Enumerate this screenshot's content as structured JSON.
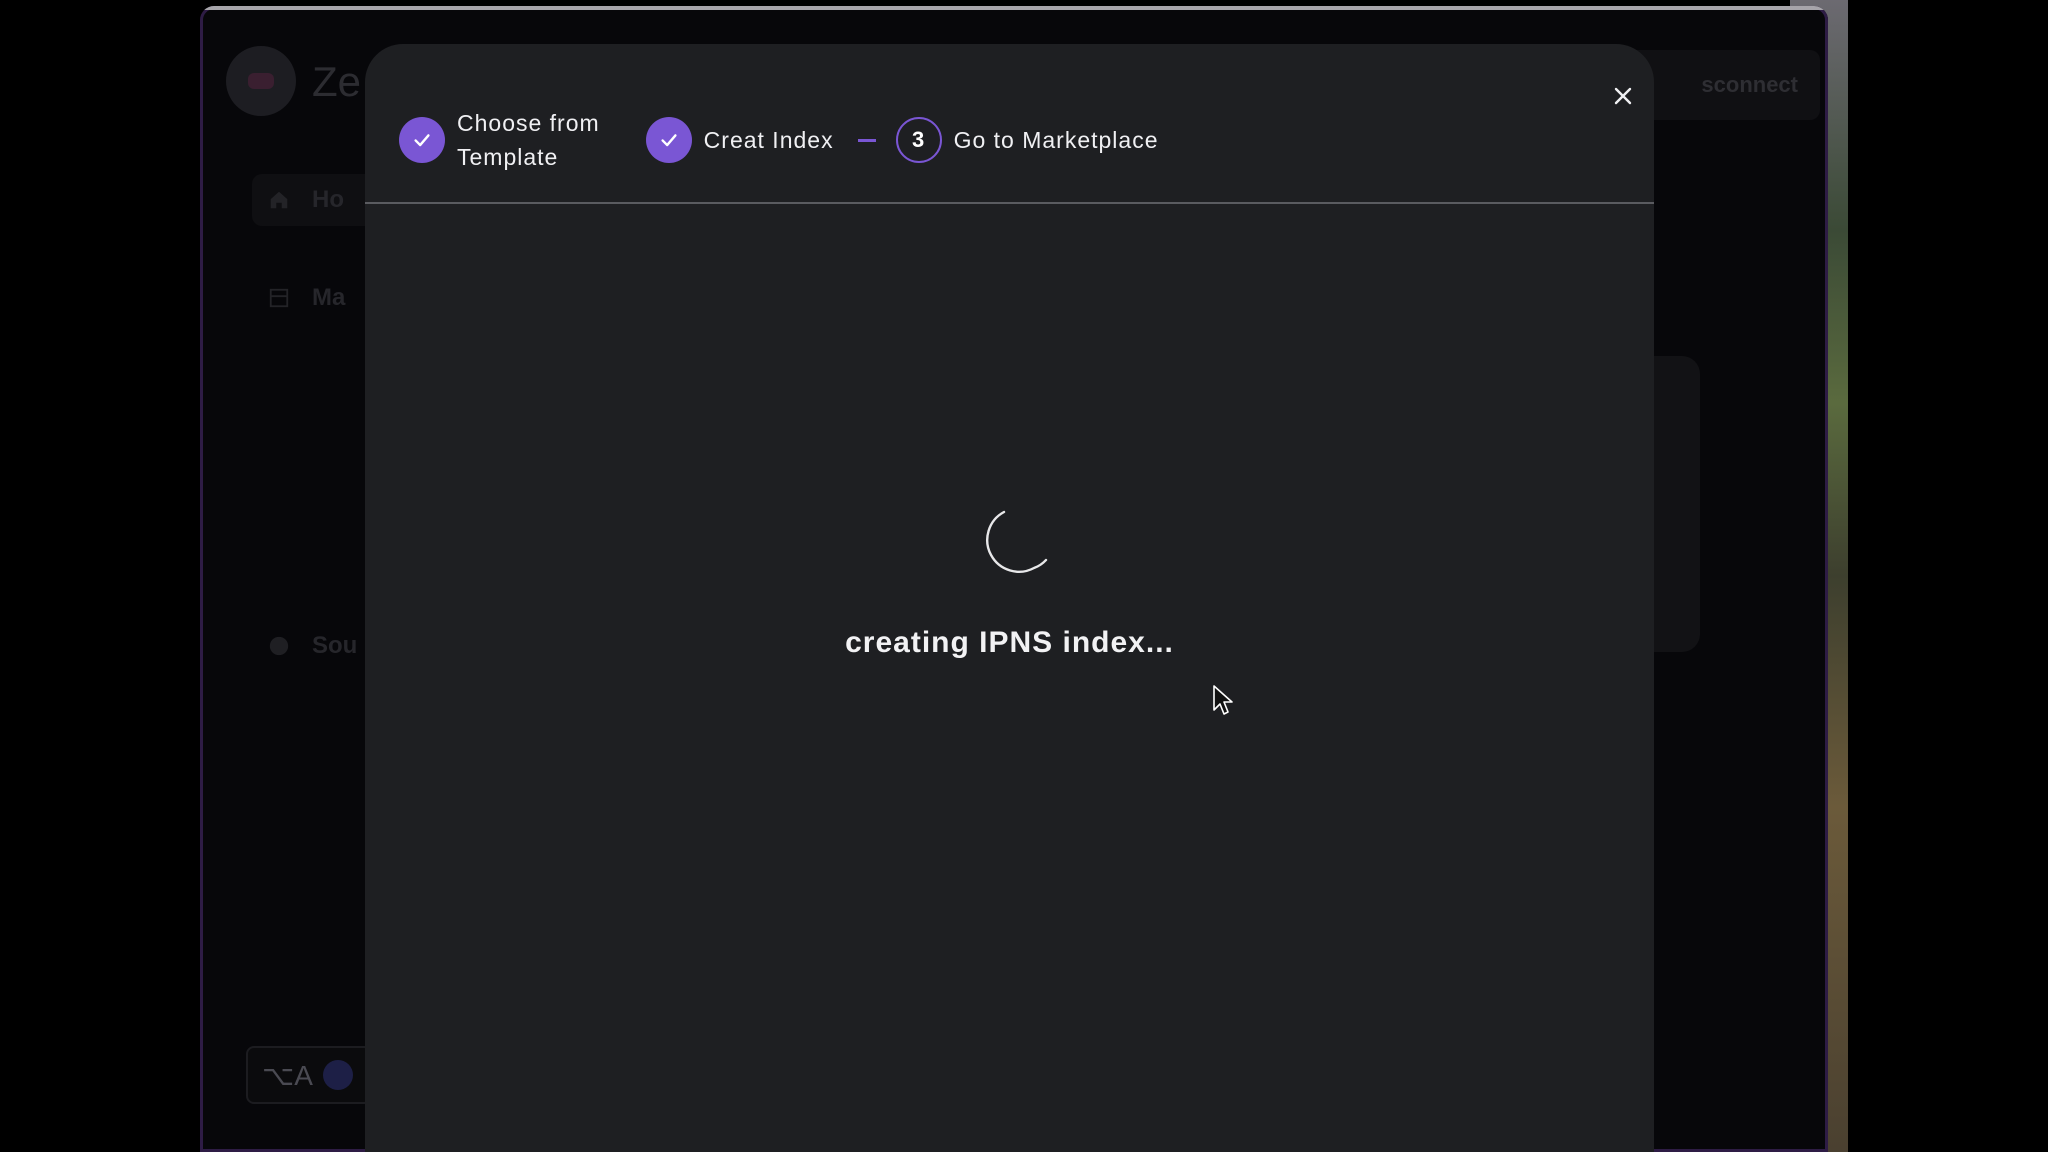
{
  "background_app": {
    "brand": "Ze",
    "nav": [
      {
        "label": "Ho",
        "icon": "home-icon"
      },
      {
        "label": "Ma",
        "icon": "grid-icon"
      },
      {
        "label": "Sou",
        "icon": "github-icon"
      }
    ],
    "disconnect_label": "sconnect",
    "keyboard_hint": "⌥A"
  },
  "modal": {
    "steps": [
      {
        "label_line1": "Choose from",
        "label_line2": "Template",
        "state": "done"
      },
      {
        "label": "Creat Index",
        "state": "done"
      },
      {
        "number": "3",
        "label": "Go to Marketplace",
        "state": "current"
      }
    ],
    "loading_text": "creating IPNS index...",
    "close_icon": "close-icon"
  },
  "colors": {
    "accent": "#7a56d4",
    "modal_bg": "#1e1f22",
    "text": "#f0f0f3"
  }
}
